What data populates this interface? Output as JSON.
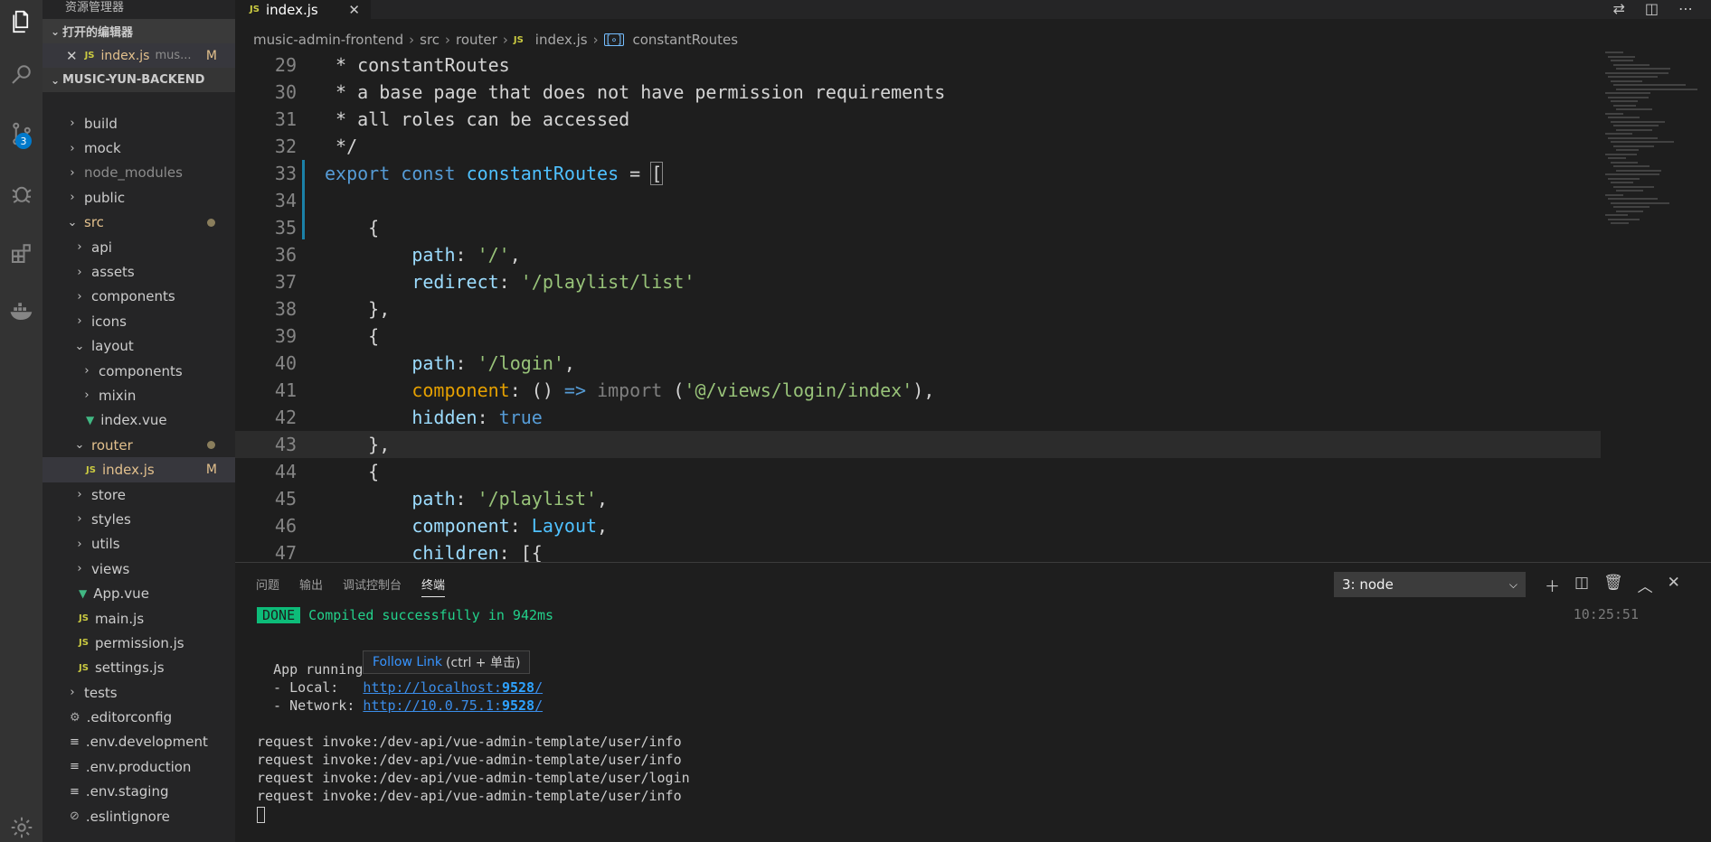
{
  "explorer": {
    "title": "资源管理器",
    "open_editors_label": "打开的编辑器",
    "open_editor": {
      "name": "index.js",
      "path": "mus...",
      "status": "M"
    },
    "project_label": "MUSIC-YUN-BACKEND"
  },
  "activity": {
    "scm_badge": "3"
  },
  "tree": [
    {
      "name": "build",
      "type": "folder",
      "depth": 0,
      "state": "collapsed"
    },
    {
      "name": "mock",
      "type": "folder",
      "depth": 0,
      "state": "collapsed"
    },
    {
      "name": "node_modules",
      "type": "folder",
      "depth": 0,
      "state": "collapsed",
      "dim": true
    },
    {
      "name": "public",
      "type": "folder",
      "depth": 0,
      "state": "collapsed"
    },
    {
      "name": "src",
      "type": "folder",
      "depth": 0,
      "state": "expanded",
      "modified": true
    },
    {
      "name": "api",
      "type": "folder",
      "depth": 1,
      "state": "collapsed"
    },
    {
      "name": "assets",
      "type": "folder",
      "depth": 1,
      "state": "collapsed"
    },
    {
      "name": "components",
      "type": "folder",
      "depth": 1,
      "state": "collapsed"
    },
    {
      "name": "icons",
      "type": "folder",
      "depth": 1,
      "state": "collapsed"
    },
    {
      "name": "layout",
      "type": "folder",
      "depth": 1,
      "state": "expanded"
    },
    {
      "name": "components",
      "type": "folder",
      "depth": 2,
      "state": "collapsed"
    },
    {
      "name": "mixin",
      "type": "folder",
      "depth": 2,
      "state": "collapsed"
    },
    {
      "name": "index.vue",
      "type": "vue",
      "depth": 2
    },
    {
      "name": "router",
      "type": "folder",
      "depth": 1,
      "state": "expanded",
      "modified": true
    },
    {
      "name": "index.js",
      "type": "js",
      "depth": 2,
      "selected": true,
      "status": "M"
    },
    {
      "name": "store",
      "type": "folder",
      "depth": 1,
      "state": "collapsed"
    },
    {
      "name": "styles",
      "type": "folder",
      "depth": 1,
      "state": "collapsed"
    },
    {
      "name": "utils",
      "type": "folder",
      "depth": 1,
      "state": "collapsed"
    },
    {
      "name": "views",
      "type": "folder",
      "depth": 1,
      "state": "collapsed"
    },
    {
      "name": "App.vue",
      "type": "vue",
      "depth": 1
    },
    {
      "name": "main.js",
      "type": "js",
      "depth": 1
    },
    {
      "name": "permission.js",
      "type": "js",
      "depth": 1
    },
    {
      "name": "settings.js",
      "type": "js",
      "depth": 1
    },
    {
      "name": "tests",
      "type": "folder",
      "depth": 0,
      "state": "collapsed"
    },
    {
      "name": ".editorconfig",
      "type": "gear",
      "depth": 0
    },
    {
      "name": ".env.development",
      "type": "lines",
      "depth": 0
    },
    {
      "name": ".env.production",
      "type": "lines",
      "depth": 0
    },
    {
      "name": ".env.staging",
      "type": "lines",
      "depth": 0
    },
    {
      "name": ".eslintignore",
      "type": "circle",
      "depth": 0
    }
  ],
  "editor": {
    "tab_label": "index.js",
    "breadcrumb": [
      "music-admin-frontend",
      "src",
      "router",
      "index.js",
      "constantRoutes"
    ]
  },
  "code_lines": [
    {
      "n": "29",
      "html": "<span class='cm'> * constantRoutes</span>"
    },
    {
      "n": "30",
      "html": "<span class='cm'> * a base page that does not have permission requirements</span>"
    },
    {
      "n": "31",
      "html": "<span class='cm'> * all roles can be accessed</span>"
    },
    {
      "n": "32",
      "html": "<span class='cm'> */</span>"
    },
    {
      "n": "33",
      "html": "<span class='kw'>export</span> <span class='kw'>const</span> <span class='var'>constantRoutes</span> = <span class='bracket'>[</span>"
    },
    {
      "n": "34",
      "html": ""
    },
    {
      "n": "35",
      "html": "    {"
    },
    {
      "n": "36",
      "html": "        <span class='prop'>path</span>: <span class='strg'>'/'</span>,"
    },
    {
      "n": "37",
      "html": "        <span class='prop'>redirect</span>: <span class='strg'>'/playlist/list'</span>"
    },
    {
      "n": "38",
      "html": "    },"
    },
    {
      "n": "39",
      "html": "    {"
    },
    {
      "n": "40",
      "html": "        <span class='prop'>path</span>: <span class='strg'>'/login'</span>,"
    },
    {
      "n": "41",
      "html": "        <span class='orange'>component</span>: () <span class='kw'>=&gt;</span> <span class='imp'>import</span> (<span class='strg'>'@/views/login/index'</span>),"
    },
    {
      "n": "42",
      "html": "        <span class='prop'>hidden</span>: <span class='bool'>true</span>"
    },
    {
      "n": "43",
      "html": "    },",
      "hl": true
    },
    {
      "n": "44",
      "html": "    {"
    },
    {
      "n": "45",
      "html": "        <span class='prop'>path</span>: <span class='strg'>'/playlist'</span>,"
    },
    {
      "n": "46",
      "html": "        <span class='prop'>component</span>: <span class='var'>Layout</span>,"
    },
    {
      "n": "47",
      "html": "        <span class='prop'>children</span>: [{"
    }
  ],
  "panel": {
    "tabs": [
      "问题",
      "输出",
      "调试控制台",
      "终端"
    ],
    "active_tab": "终端",
    "terminal_select": "3: node"
  },
  "terminal": {
    "done_badge": "DONE",
    "compiled": "Compiled successfully in 942ms",
    "time": "10:25:51",
    "app_running": "App running at:",
    "local_label": "  - Local:   ",
    "local_url_prefix": "http://localhost:",
    "local_port": "9528",
    "network_label": "  - Network: ",
    "network_url_prefix": "http://10.0.75.1:",
    "network_port": "9528",
    "requests": [
      "request invoke:/dev-api/vue-admin-template/user/info",
      "request invoke:/dev-api/vue-admin-template/user/info",
      "request invoke:/dev-api/vue-admin-template/user/login",
      "request invoke:/dev-api/vue-admin-template/user/info"
    ]
  },
  "tooltip": {
    "link_text": "Follow Link",
    "hint": "(ctrl + 单击)"
  }
}
